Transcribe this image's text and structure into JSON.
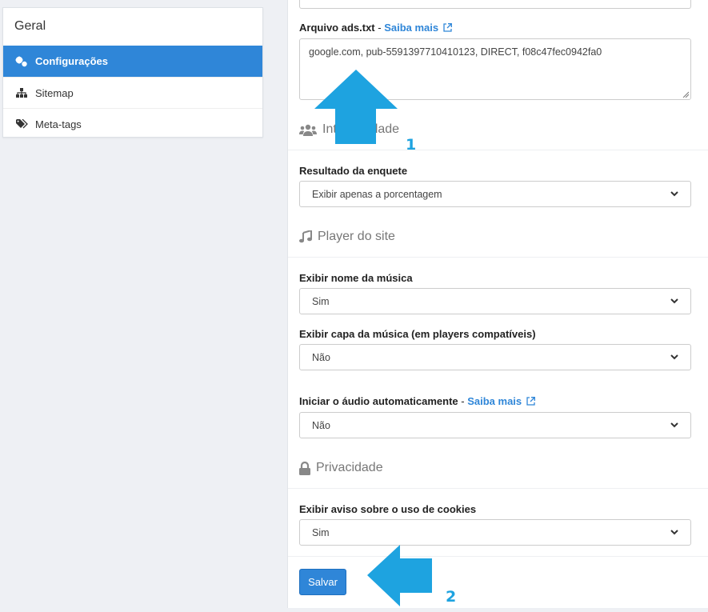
{
  "sidebar": {
    "title": "Geral",
    "items": [
      {
        "label": "Configurações",
        "icon": "gears-icon",
        "active": true
      },
      {
        "label": "Sitemap",
        "icon": "sitemap-icon"
      },
      {
        "label": "Meta-tags",
        "icon": "tags-icon"
      }
    ]
  },
  "ads": {
    "label": "Arquivo ads.txt",
    "separator": " - ",
    "link": "Saiba mais",
    "value": "google.com, pub-5591397710410123, DIRECT, f08c47fec0942fa0"
  },
  "sections": {
    "interactivity": {
      "title": "Interatividade",
      "icon": "users-icon"
    },
    "player": {
      "title": "Player do site",
      "icon": "music-icon"
    },
    "privacy": {
      "title": "Privacidade",
      "icon": "lock-icon"
    }
  },
  "fields": {
    "poll_result": {
      "label": "Resultado da enquete",
      "value": "Exibir apenas a porcentagem"
    },
    "show_song_name": {
      "label": "Exibir nome da música",
      "value": "Sim"
    },
    "show_song_cover": {
      "label": "Exibir capa da música (em players compatíveis)",
      "value": "Não"
    },
    "autoplay": {
      "label": "Iniciar o áudio automaticamente",
      "separator": " - ",
      "link": "Saiba mais",
      "value": "Não"
    },
    "cookie_notice": {
      "label": "Exibir aviso sobre o uso de cookies",
      "value": "Sim"
    }
  },
  "actions": {
    "save": "Salvar"
  },
  "annotations": {
    "marker_1": "1",
    "marker_2": "2",
    "arrow_color": "#1ea3e0"
  },
  "colors": {
    "primary": "#2f86d8",
    "arrow": "#1ea3e0"
  }
}
